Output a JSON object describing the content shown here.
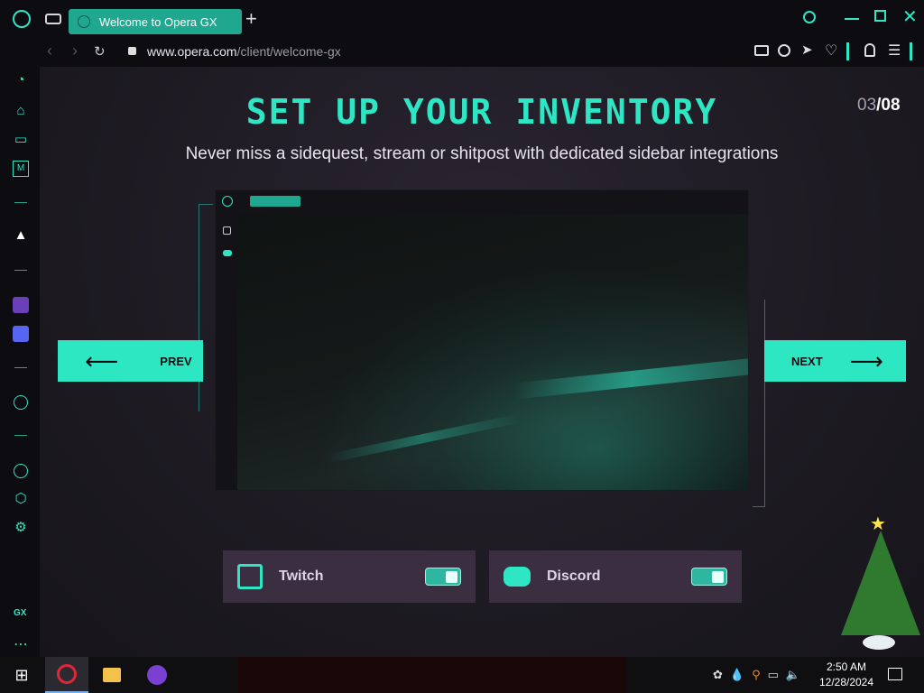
{
  "browser": {
    "tab_title": "Welcome to Opera GX",
    "new_tab_glyph": "+",
    "url_host": "www.opera.com",
    "url_path": "/client/welcome-gx",
    "window_controls": [
      "minimize-icon",
      "restore-icon",
      "close-icon"
    ]
  },
  "sidebar": {
    "icons": [
      "gx-control-icon",
      "gx-cleaner-icon",
      "gx-corner-icon",
      "player-icon",
      "aria-icon",
      "twitch-icon",
      "discord-icon",
      "play-icon",
      "history-icon",
      "extensions-icon",
      "settings-icon"
    ],
    "gx_label": "GX",
    "more_label": "⋯"
  },
  "page": {
    "title": "SET UP YOUR INVENTORY",
    "counter_current": "03",
    "counter_sep": "/",
    "counter_total": "08",
    "subtitle": "Never miss a sidequest, stream or shitpost with dedicated sidebar integrations",
    "prev_label": "PREV",
    "next_label": "NEXT",
    "integrations": [
      {
        "name": "Twitch",
        "icon": "twitch-icon",
        "enabled": true
      },
      {
        "name": "Discord",
        "icon": "discord-icon",
        "enabled": true
      }
    ]
  },
  "taskbar": {
    "time": "2:50 AM",
    "date": "12/28/2024"
  },
  "colors": {
    "accent": "#2de6c2",
    "background": "#1d1a22",
    "card": "#3a2e40"
  }
}
